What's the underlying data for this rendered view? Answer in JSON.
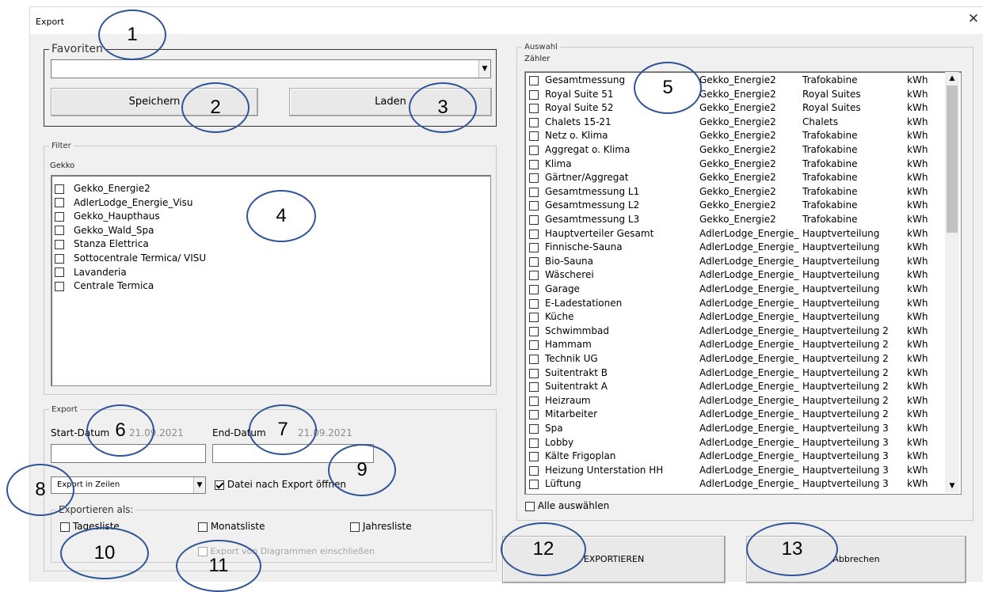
{
  "window": {
    "title": "Export",
    "close_glyph": "✕"
  },
  "favoriten": {
    "legend": "Favoriten",
    "selected": "",
    "save_label": "Speichern",
    "load_label": "Laden"
  },
  "filter": {
    "legend": "Filter",
    "sublabel": "Gekko",
    "items": [
      {
        "label": "Gekko_Energie2",
        "checked": false
      },
      {
        "label": "AdlerLodge_Energie_Visu",
        "checked": false
      },
      {
        "label": "Gekko_Haupthaus",
        "checked": false
      },
      {
        "label": "Gekko_Wald_Spa",
        "checked": false
      },
      {
        "label": "Stanza Elettrica",
        "checked": false
      },
      {
        "label": "Sottocentrale Termica/ VISU",
        "checked": false
      },
      {
        "label": "Lavanderia",
        "checked": false
      },
      {
        "label": "Centrale Termica",
        "checked": false
      }
    ]
  },
  "export": {
    "legend": "Export",
    "start_label": "Start-Datum",
    "start_hint": "21.09.2021",
    "end_label": "End-Datum",
    "end_hint": "21.09.2021",
    "start_value": "",
    "end_value": "",
    "mode_selected": "Export in Zeilen",
    "open_after_label": "Datei nach Export öffnen",
    "open_after_checked": true,
    "as_legend": "Exportieren als:",
    "daily_label": "Tagesliste",
    "monthly_label": "Monatsliste",
    "yearly_label": "Jahresliste",
    "diagrams_label": "Export von Diagrammen einschließen"
  },
  "auswahl": {
    "legend": "Auswahl",
    "sublabel": "Zähler",
    "select_all_label": "Alle auswählen",
    "rows": [
      [
        "Gesamtmessung",
        "Gekko_Energie2",
        "Trafokabine",
        "kWh"
      ],
      [
        "Royal Suite 51",
        "Gekko_Energie2",
        "Royal Suites",
        "kWh"
      ],
      [
        "Royal Suite 52",
        "Gekko_Energie2",
        "Royal Suites",
        "kWh"
      ],
      [
        "Chalets 15-21",
        "Gekko_Energie2",
        "Chalets",
        "kWh"
      ],
      [
        "Netz o. Klima",
        "Gekko_Energie2",
        "Trafokabine",
        "kWh"
      ],
      [
        "Aggregat o. Klima",
        "Gekko_Energie2",
        "Trafokabine",
        "kWh"
      ],
      [
        "Klima",
        "Gekko_Energie2",
        "Trafokabine",
        "kWh"
      ],
      [
        "Gärtner/Aggregat",
        "Gekko_Energie2",
        "Trafokabine",
        "kWh"
      ],
      [
        "Gesamtmessung L1",
        "Gekko_Energie2",
        "Trafokabine",
        "kWh"
      ],
      [
        "Gesamtmessung L2",
        "Gekko_Energie2",
        "Trafokabine",
        "kWh"
      ],
      [
        "Gesamtmessung L3",
        "Gekko_Energie2",
        "Trafokabine",
        "kWh"
      ],
      [
        "Hauptverteiler Gesamt",
        "AdlerLodge_Energie_",
        "Hauptverteilung",
        "kWh"
      ],
      [
        "Finnische-Sauna",
        "AdlerLodge_Energie_",
        "Hauptverteilung",
        "kWh"
      ],
      [
        "Bio-Sauna",
        "AdlerLodge_Energie_",
        "Hauptverteilung",
        "kWh"
      ],
      [
        "Wäscherei",
        "AdlerLodge_Energie_",
        "Hauptverteilung",
        "kWh"
      ],
      [
        "Garage",
        "AdlerLodge_Energie_",
        "Hauptverteilung",
        "kWh"
      ],
      [
        "E-Ladestationen",
        "AdlerLodge_Energie_",
        "Hauptverteilung",
        "kWh"
      ],
      [
        "Küche",
        "AdlerLodge_Energie_",
        "Hauptverteilung",
        "kWh"
      ],
      [
        "Schwimmbad",
        "AdlerLodge_Energie_",
        "Hauptverteilung 2",
        "kWh"
      ],
      [
        "Hammam",
        "AdlerLodge_Energie_",
        "Hauptverteilung 2",
        "kWh"
      ],
      [
        "Technik UG",
        "AdlerLodge_Energie_",
        "Hauptverteilung 2",
        "kWh"
      ],
      [
        "Suitentrakt B",
        "AdlerLodge_Energie_",
        "Hauptverteilung 2",
        "kWh"
      ],
      [
        "Suitentrakt A",
        "AdlerLodge_Energie_",
        "Hauptverteilung 2",
        "kWh"
      ],
      [
        "Heizraum",
        "AdlerLodge_Energie_",
        "Hauptverteilung 2",
        "kWh"
      ],
      [
        "Mitarbeiter",
        "AdlerLodge_Energie_",
        "Hauptverteilung 2",
        "kWh"
      ],
      [
        "Spa",
        "AdlerLodge_Energie_",
        "Hauptverteilung 3",
        "kWh"
      ],
      [
        "Lobby",
        "AdlerLodge_Energie_",
        "Hauptverteilung 3",
        "kWh"
      ],
      [
        "Kälte Frigoplan",
        "AdlerLodge_Energie_",
        "Hauptverteilung 3",
        "kWh"
      ],
      [
        "Heizung Unterstation HH",
        "AdlerLodge_Energie_",
        "Hauptverteilung 3",
        "kWh"
      ],
      [
        "Lüftung",
        "AdlerLodge_Energie_",
        "Hauptverteilung 3",
        "kWh"
      ]
    ]
  },
  "buttons": {
    "export_label": "EXPORTIEREN",
    "cancel_label": "Abbrechen"
  },
  "annotations": [
    "1",
    "2",
    "3",
    "4",
    "5",
    "6",
    "7",
    "8",
    "9",
    "10",
    "11",
    "12",
    "13"
  ],
  "colors": {
    "annotation_ring": "#2f5597",
    "dialog_bg": "#f0f0f0"
  }
}
